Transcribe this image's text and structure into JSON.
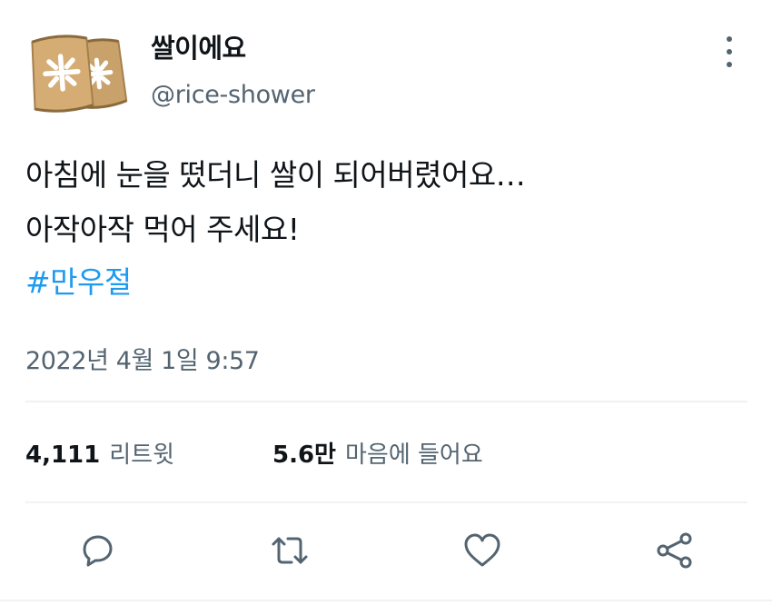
{
  "tweet": {
    "display_name": "쌀이에요",
    "handle": "@rice-shower",
    "text_line1": "아침에 눈을 떴더니 쌀이 되어버렸어요…",
    "text_line2": "아작아작 먹어 주세요!",
    "hashtag": "#만우절",
    "timestamp": "2022년 4월 1일 9:57"
  },
  "stats": {
    "retweets_count": "4,111",
    "retweets_label": "리트윗",
    "likes_count": "5.6만",
    "likes_label": "마음에 들어요"
  },
  "actions": {
    "icons": [
      "reply-icon",
      "retweet-icon",
      "like-icon",
      "share-icon"
    ]
  },
  "colors": {
    "text": "#0f1419",
    "secondary": "#536471",
    "hashtag": "#1d9bf0",
    "divider": "#eff3f4",
    "avatar_bag": "#c9a16b"
  }
}
